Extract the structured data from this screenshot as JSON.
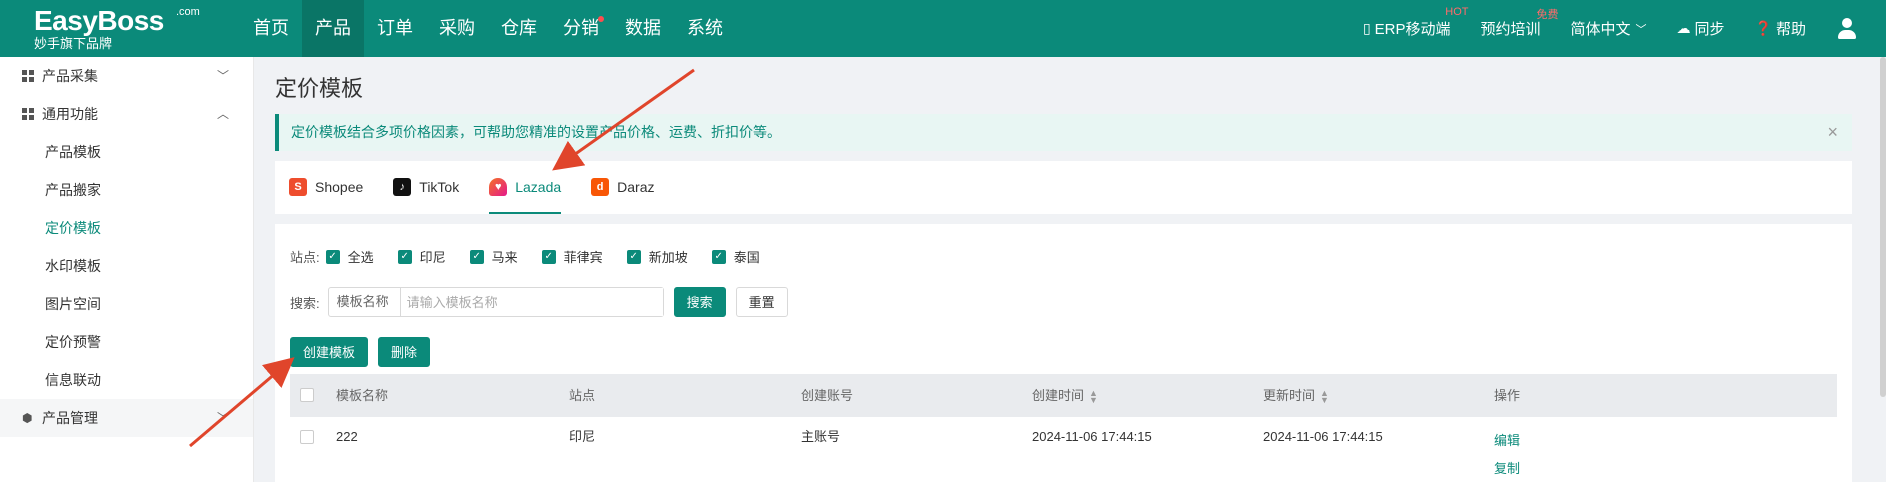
{
  "topbar": {
    "logo": "EasyBoss",
    "logo_com": ".com",
    "logo_sub": "妙手旗下品牌",
    "nav": [
      "首页",
      "产品",
      "订单",
      "采购",
      "仓库",
      "分销",
      "数据",
      "系统"
    ],
    "right": {
      "erp": "ERP移动端",
      "erp_badge": "HOT",
      "training": "预约培训",
      "training_badge": "免费",
      "language": "简体中文",
      "sync": "同步",
      "help": "帮助"
    }
  },
  "sidebar": {
    "group1": "产品采集",
    "group2": "通用功能",
    "items": [
      "产品模板",
      "产品搬家",
      "定价模板",
      "水印模板",
      "图片空间",
      "定价预警",
      "信息联动"
    ],
    "group3": "产品管理"
  },
  "main": {
    "title": "定价模板",
    "notice": "定价模板结合多项价格因素，可帮助您精准的设置产品价格、运费、折扣价等。",
    "tabs": [
      "Shopee",
      "TikTok",
      "Lazada",
      "Daraz"
    ],
    "sites_label": "站点:",
    "sites": [
      "全选",
      "印尼",
      "马来",
      "菲律宾",
      "新加坡",
      "泰国"
    ],
    "search_label": "搜索:",
    "search_select": "模板名称",
    "search_placeholder": "请输入模板名称",
    "search_btn": "搜索",
    "reset_btn": "重置",
    "create_btn": "创建模板",
    "delete_btn": "删除",
    "columns": [
      "模板名称",
      "站点",
      "创建账号",
      "创建时间",
      "更新时间",
      "操作"
    ],
    "rows": [
      {
        "name": "222",
        "site": "印尼",
        "account": "主账号",
        "created": "2024-11-06 17:44:15",
        "updated": "2024-11-06 17:44:15",
        "ops": [
          "编辑",
          "复制"
        ]
      }
    ]
  },
  "colors": {
    "brand": "#0b8a7a",
    "arrow": "#e0452b"
  }
}
